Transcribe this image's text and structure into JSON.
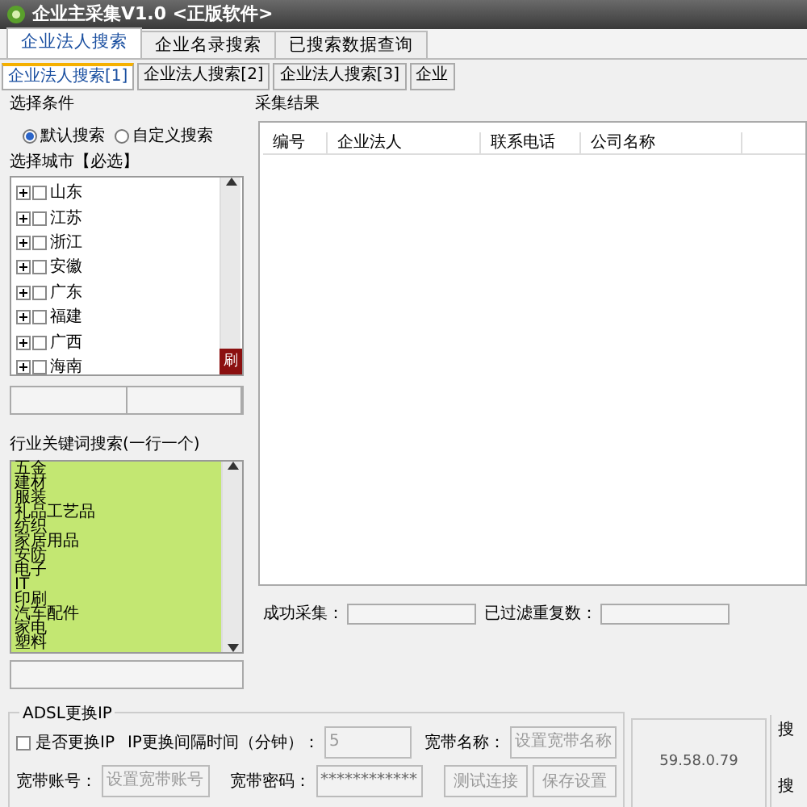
{
  "window": {
    "title": "企业主采集V1.0 <正版软件>"
  },
  "top_tabs": [
    {
      "label": "企业法人搜索",
      "selected": true
    },
    {
      "label": "企业名录搜索",
      "selected": false
    },
    {
      "label": "已搜索数据查询",
      "selected": false
    }
  ],
  "sub_tabs": [
    {
      "label": "企业法人搜索[1]",
      "selected": true
    },
    {
      "label": "企业法人搜索[2]",
      "selected": false
    },
    {
      "label": "企业法人搜索[3]",
      "selected": false
    },
    {
      "label": "企业",
      "selected": false
    }
  ],
  "conditions": {
    "title": "选择条件",
    "radios": [
      {
        "label": "默认搜索",
        "selected": true
      },
      {
        "label": "自定义搜索",
        "selected": false
      }
    ],
    "city_label": "选择城市【必选】",
    "cities": [
      {
        "label": "山东",
        "checked": false
      },
      {
        "label": "江苏",
        "checked": false
      },
      {
        "label": "浙江",
        "checked": false
      },
      {
        "label": "安徽",
        "checked": false
      },
      {
        "label": "广东",
        "checked": false
      },
      {
        "label": "福建",
        "checked": false
      },
      {
        "label": "广西",
        "checked": false
      },
      {
        "label": "海南",
        "checked": false
      }
    ],
    "refresh_button": "刷"
  },
  "keywords": {
    "label": "行业关键词搜索(一行一个)",
    "lines": [
      "五金",
      "建材",
      "服装",
      "礼品工艺品",
      "纺织",
      "家居用品",
      "安防",
      "电子",
      "IT",
      "印刷",
      "汽车配件",
      "家电",
      "塑料"
    ]
  },
  "results": {
    "title": "采集结果",
    "columns": [
      "编号",
      "企业法人",
      "联系电话",
      "公司名称"
    ],
    "success_label": "成功采集：",
    "dup_label": "已过滤重复数："
  },
  "adsl": {
    "title": "ADSL更换IP",
    "change_ip": {
      "label": "是否更换IP",
      "checked": false
    },
    "interval_label": "IP更换间隔时间（分钟）：",
    "interval_value": "5",
    "bb_name_label": "宽带名称：",
    "bb_name_placeholder": "设置宽带名称",
    "account_label": "宽带账号：",
    "account_placeholder": "设置宽带账号",
    "password_label": "宽带密码：",
    "password_value": "************",
    "test_button": "测试连接",
    "save_button": "保存设置",
    "ip": "59.58.0.79"
  },
  "right_edge": [
    "搜",
    "搜"
  ]
}
